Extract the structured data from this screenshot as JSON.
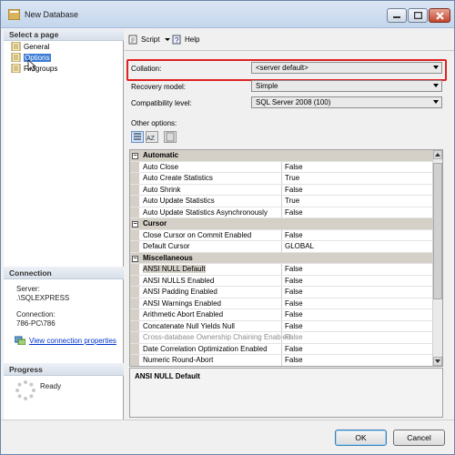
{
  "window": {
    "title": "New Database"
  },
  "left_panel": {
    "select_page_header": "Select a page",
    "nav_items": [
      {
        "label": "General"
      },
      {
        "label": "Options"
      },
      {
        "label": "Filegroups"
      }
    ],
    "connection_header": "Connection",
    "server_label": "Server:",
    "server_value": ".\\SQLEXPRESS",
    "connection_label": "Connection:",
    "connection_value": "786-PC\\786",
    "view_connection_link": "View connection properties",
    "progress_header": "Progress",
    "progress_status": "Ready"
  },
  "toolbar": {
    "script_label": "Script",
    "help_label": "Help"
  },
  "form": {
    "collation_label": "Collation:",
    "collation_value": "<server default>",
    "recovery_label": "Recovery model:",
    "recovery_value": "Simple",
    "compat_label": "Compatibility level:",
    "compat_value": "SQL Server 2008 (100)",
    "other_options_label": "Other options:"
  },
  "options_grid": {
    "rows": [
      {
        "kind": "category",
        "name": "Automatic"
      },
      {
        "name": "Auto Close",
        "value": "False"
      },
      {
        "name": "Auto Create Statistics",
        "value": "True"
      },
      {
        "name": "Auto Shrink",
        "value": "False"
      },
      {
        "name": "Auto Update Statistics",
        "value": "True"
      },
      {
        "name": "Auto Update Statistics Asynchronously",
        "value": "False"
      },
      {
        "kind": "category",
        "name": "Cursor"
      },
      {
        "name": "Close Cursor on Commit Enabled",
        "value": "False"
      },
      {
        "name": "Default Cursor",
        "value": "GLOBAL"
      },
      {
        "kind": "category",
        "name": "Miscellaneous"
      },
      {
        "name": "ANSI NULL Default",
        "value": "False",
        "selected": true
      },
      {
        "name": "ANSI NULLS Enabled",
        "value": "False"
      },
      {
        "name": "ANSI Padding Enabled",
        "value": "False"
      },
      {
        "name": "ANSI Warnings Enabled",
        "value": "False"
      },
      {
        "name": "Arithmetic Abort Enabled",
        "value": "False"
      },
      {
        "name": "Concatenate Null Yields Null",
        "value": "False"
      },
      {
        "name": "Cross-database Ownership Chaining Enabled",
        "value": "False",
        "disabled": true
      },
      {
        "name": "Date Correlation Optimization Enabled",
        "value": "False"
      },
      {
        "name": "Numeric Round-Abort",
        "value": "False"
      }
    ]
  },
  "description": {
    "title": "ANSI NULL Default"
  },
  "buttons": {
    "ok_label": "OK",
    "cancel_label": "Cancel"
  },
  "colors": {
    "highlight_border": "#e02020",
    "link": "#0033cc"
  }
}
